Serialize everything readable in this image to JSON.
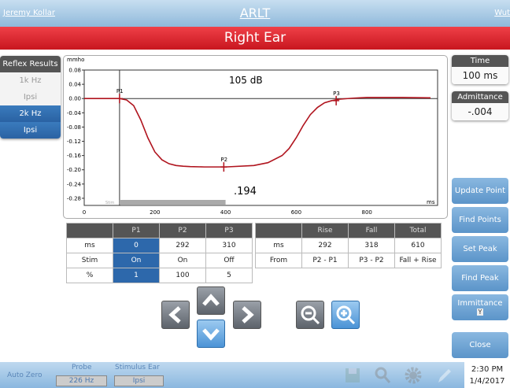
{
  "header": {
    "user": "Jeremy Kollar",
    "title": "ARLT",
    "right": "Wut"
  },
  "ear": "Right Ear",
  "reflex": {
    "title": "Reflex Results",
    "items": [
      {
        "freq": "1k Hz",
        "mode": "Ipsi",
        "selected": false
      },
      {
        "freq": "2k Hz",
        "mode": "Ipsi",
        "selected": true
      }
    ]
  },
  "chart_data": {
    "type": "line",
    "ylabel": "mmho",
    "xlabel": "ms",
    "annotation": "105 dB",
    "value_label": ".194",
    "stim_label": "Stim",
    "xlim": [
      0,
      1000
    ],
    "ylim": [
      -0.3,
      0.08
    ],
    "xticks": [
      200,
      400,
      600,
      800
    ],
    "xtick_labels": [
      "0",
      "200",
      "400",
      "600",
      "800"
    ],
    "yticks": [
      "0.08",
      "0.04",
      "0.00",
      "-0.04",
      "-0.08",
      "-0.12",
      "-0.16",
      "-0.20",
      "-0.24",
      "-0.28"
    ],
    "series": [
      {
        "color": "#b0141e",
        "x": [
          0,
          100,
          120,
          140,
          160,
          180,
          200,
          220,
          240,
          260,
          280,
          300,
          340,
          400,
          480,
          520,
          560,
          580,
          600,
          620,
          640,
          660,
          680,
          700,
          720,
          760,
          800,
          900,
          980
        ],
        "y": [
          0,
          0,
          -0.004,
          -0.02,
          -0.06,
          -0.11,
          -0.15,
          -0.172,
          -0.183,
          -0.188,
          -0.19,
          -0.191,
          -0.192,
          -0.192,
          -0.188,
          -0.18,
          -0.16,
          -0.14,
          -0.11,
          -0.075,
          -0.045,
          -0.025,
          -0.012,
          -0.006,
          -0.002,
          0.001,
          0.003,
          0.003,
          0.002
        ]
      }
    ],
    "markers": [
      {
        "name": "P1",
        "x": 100,
        "y": 0
      },
      {
        "name": "P2",
        "x": 395,
        "y": -0.192
      },
      {
        "name": "P3",
        "x": 713,
        "y": -0.006
      }
    ],
    "stim_bar": [
      100,
      400
    ]
  },
  "peaks": {
    "headers": [
      "",
      "P1",
      "P2",
      "P3"
    ],
    "rows": [
      [
        "ms",
        "0",
        "292",
        "310"
      ],
      [
        "Stim",
        "On",
        "On",
        "Off"
      ],
      [
        "%",
        "1",
        "100",
        "5"
      ]
    ]
  },
  "timing": {
    "headers": [
      "",
      "Rise",
      "Fall",
      "Total"
    ],
    "rows": [
      [
        "ms",
        "292",
        "318",
        "610"
      ],
      [
        "From",
        "P2 - P1",
        "P3 - P2",
        "Fall + Rise"
      ]
    ]
  },
  "time": {
    "label": "Time",
    "value": "100 ms"
  },
  "admittance": {
    "label": "Admittance",
    "value": "-.004 mmho"
  },
  "buttons": {
    "update": "Update Point",
    "find_points": "Find Points",
    "set_peak": "Set Peak",
    "find_peak": "Find Peak",
    "immittance": "Immittance",
    "immittance_sub": "Y",
    "close": "Close"
  },
  "footer": {
    "auto_zero": "Auto Zero",
    "probe_label": "Probe",
    "probe": "226 Hz",
    "stim_label": "Stimulus Ear",
    "stim": "Ipsi",
    "time": "2:30 PM",
    "date": "1/4/2017"
  }
}
